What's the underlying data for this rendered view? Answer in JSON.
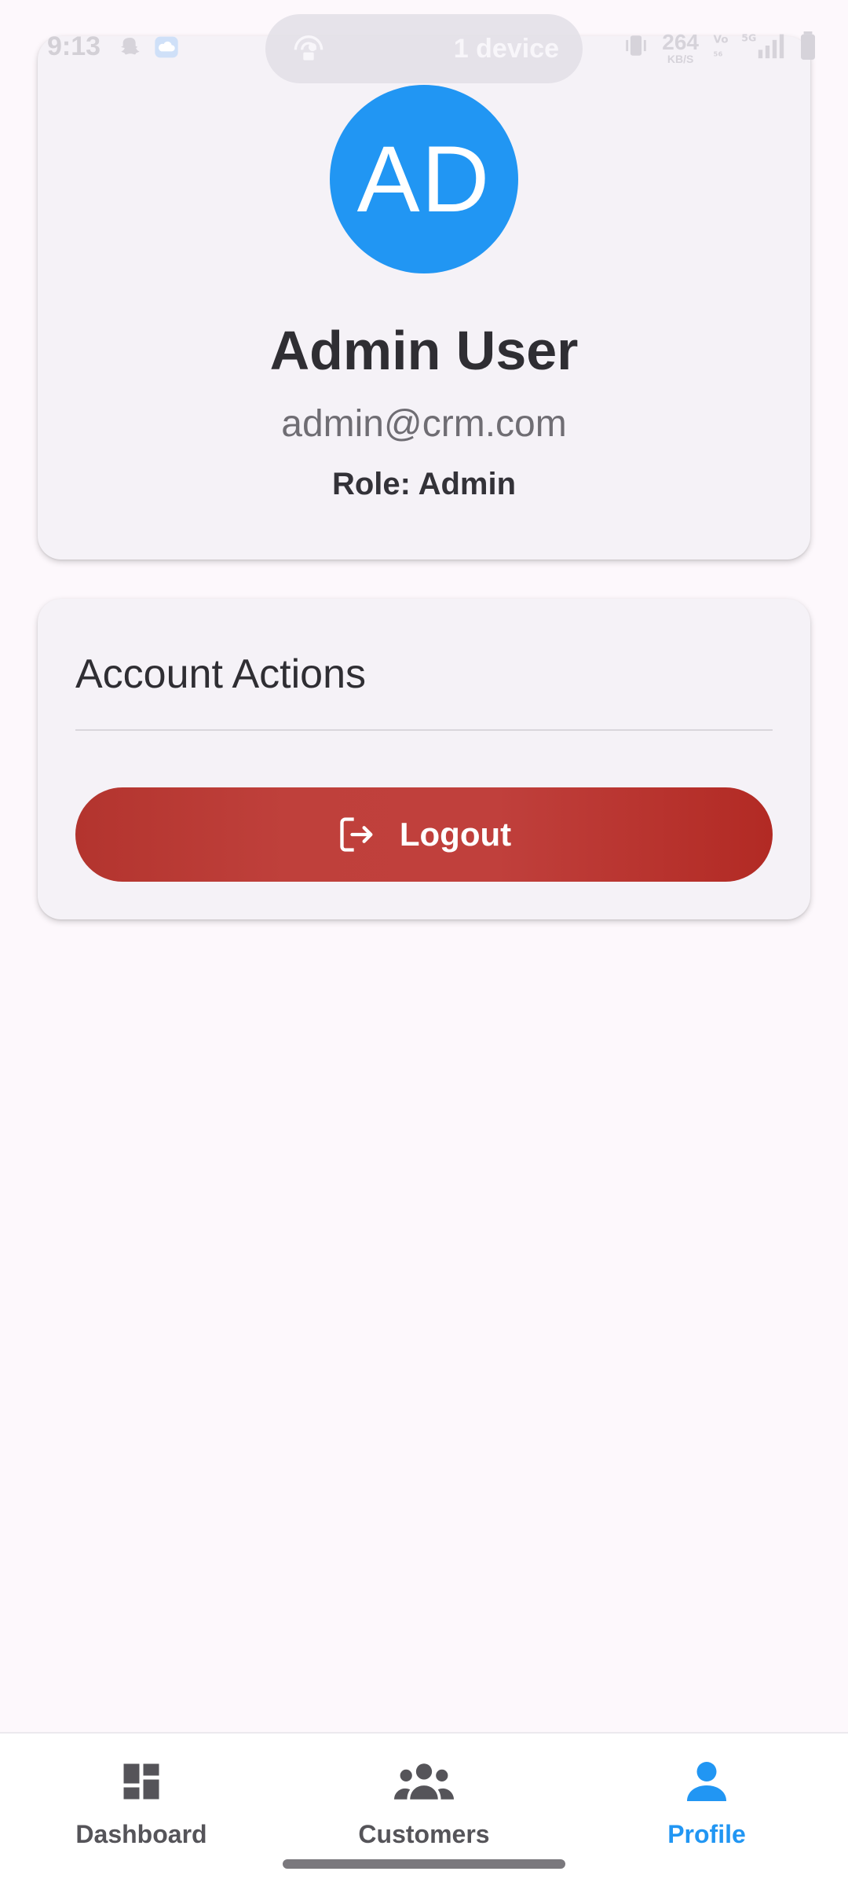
{
  "status_bar": {
    "time": "9:13",
    "device_pill": "1 device",
    "net_speed": "264",
    "net_unit": "KB/S"
  },
  "profile": {
    "initials": "AD",
    "name": "Admin User",
    "email": "admin@crm.com",
    "role": "Role: Admin",
    "avatar_color": "#2196F3"
  },
  "account_actions": {
    "title": "Account Actions",
    "logout_label": "Logout",
    "logout_color": "#C0403C"
  },
  "bottom_nav": {
    "items": [
      {
        "label": "Dashboard",
        "icon": "dashboard-icon",
        "active": false
      },
      {
        "label": "Customers",
        "icon": "people-icon",
        "active": false
      },
      {
        "label": "Profile",
        "icon": "person-icon",
        "active": true
      }
    ],
    "active_color": "#2196F3"
  }
}
